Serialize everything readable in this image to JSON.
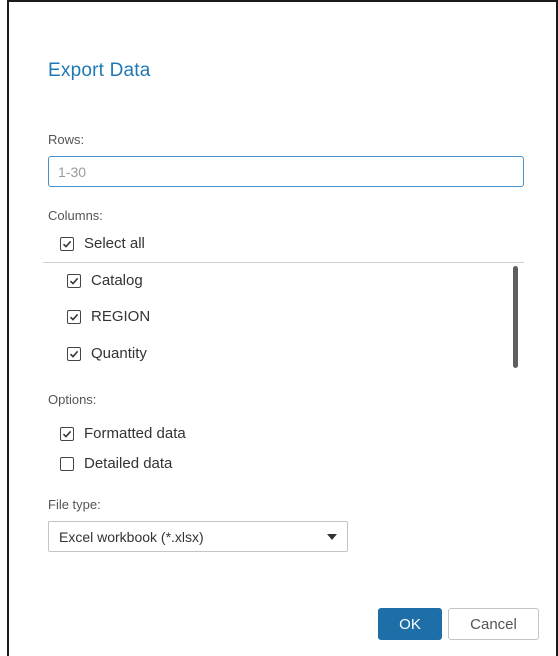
{
  "dialog": {
    "title": "Export Data",
    "rows": {
      "label": "Rows:",
      "value": "",
      "placeholder": "1-30"
    },
    "columns": {
      "label": "Columns:",
      "select_all": {
        "label": "Select all",
        "checked": true
      },
      "items": [
        {
          "label": "Catalog",
          "checked": true
        },
        {
          "label": "REGION",
          "checked": true
        },
        {
          "label": "Quantity",
          "checked": true
        }
      ]
    },
    "options": {
      "label": "Options:",
      "items": [
        {
          "label": "Formatted data",
          "checked": true
        },
        {
          "label": "Detailed data",
          "checked": false
        }
      ]
    },
    "file_type": {
      "label": "File type:",
      "selected": "Excel workbook (*.xlsx)"
    },
    "buttons": {
      "ok": "OK",
      "cancel": "Cancel"
    }
  },
  "colors": {
    "accent": "#1f78b4",
    "primary_button": "#1e6ea8",
    "input_focus_border": "#4a90c8"
  },
  "icons": {
    "checkbox_checked": "checkmark-icon",
    "dropdown": "triangle-down-icon"
  }
}
